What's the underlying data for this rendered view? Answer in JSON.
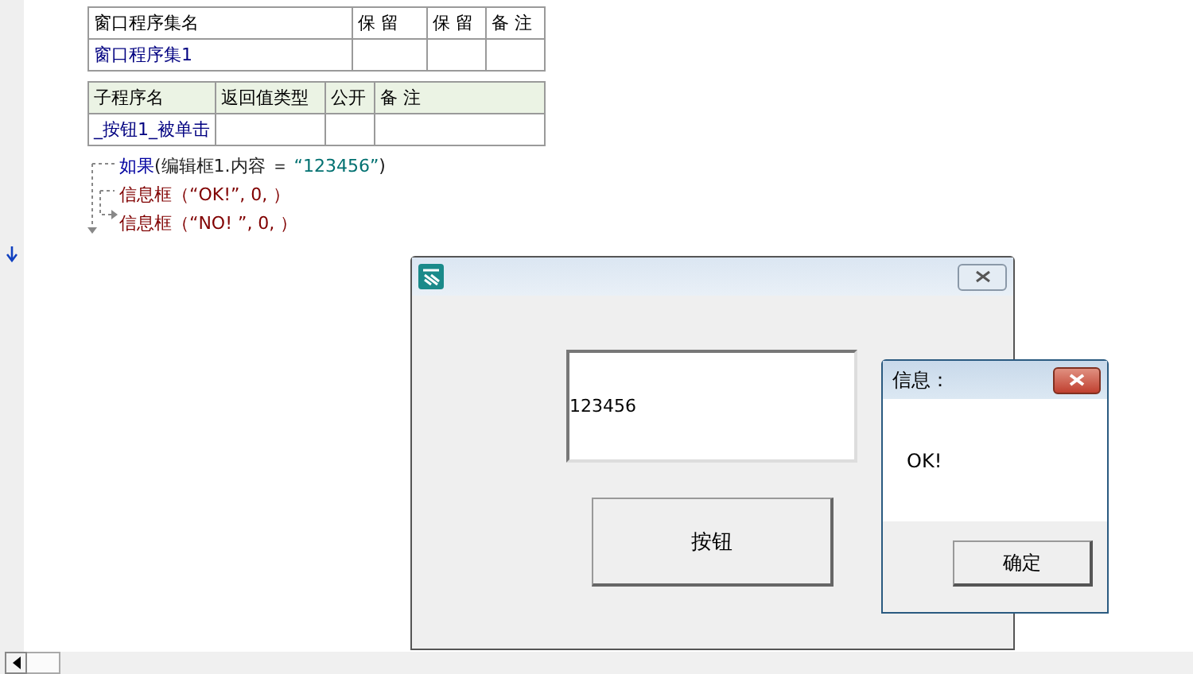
{
  "class_table": {
    "columns": [
      "窗口程序集名",
      "保 留",
      "保 留",
      "备 注"
    ],
    "rows": [
      [
        "窗口程序集1",
        "",
        "",
        ""
      ]
    ]
  },
  "sub_table": {
    "columns": [
      "子程序名",
      "返回值类型",
      "公开",
      "备 注"
    ],
    "rows": [
      [
        "_按钮1_被单击",
        "",
        "",
        ""
      ]
    ]
  },
  "code_lines": [
    {
      "segments": [
        {
          "kind": "keyword",
          "text": "如果"
        },
        {
          "kind": "plain",
          "text": "(编辑框1.内容 ＝ "
        },
        {
          "kind": "string",
          "text": "“123456”"
        },
        {
          "kind": "plain",
          "text": ")"
        }
      ]
    },
    {
      "segments": [
        {
          "kind": "call",
          "text": "信息框"
        },
        {
          "kind": "call",
          "text": "（“OK!”, 0, ）"
        }
      ]
    },
    {
      "segments": [
        {
          "kind": "call",
          "text": "信息框"
        },
        {
          "kind": "call",
          "text": "（“NO! ”, 0, ）"
        }
      ]
    }
  ],
  "form_window": {
    "edit_box": {
      "value": "123456"
    },
    "button": "按钮"
  },
  "message_box": {
    "title": "信息：",
    "message": "OK!",
    "button": "确定"
  }
}
